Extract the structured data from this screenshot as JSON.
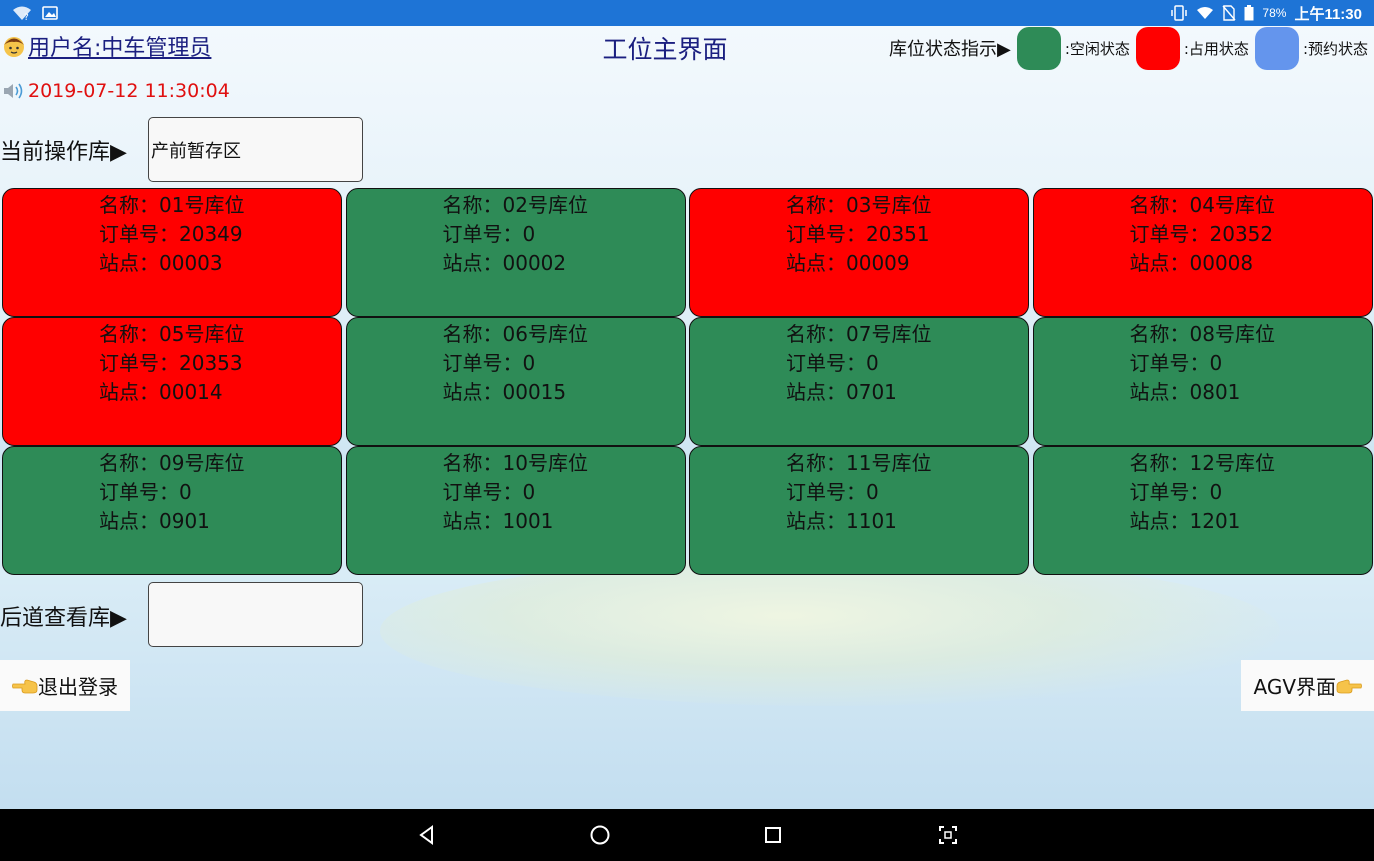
{
  "status_bar": {
    "battery": "78%",
    "time": "上午11:30",
    "icons": [
      "wifi-question-icon",
      "image-icon",
      "vibrate-icon",
      "wifi-icon",
      "no-sim-icon",
      "battery-icon"
    ]
  },
  "header": {
    "username": "用户名:中车管理员",
    "title": "工位主界面",
    "legend_title": "库位状态指示▶",
    "legend": [
      {
        "label": ":空闲状态",
        "color": "#2e8b57"
      },
      {
        "label": ":占用状态",
        "color": "#ff0000"
      },
      {
        "label": ":预约状态",
        "color": "#6495ed"
      }
    ]
  },
  "datetime": "2019-07-12 11:30:04",
  "current_store": {
    "label": "当前操作库▶",
    "value": "产前暂存区"
  },
  "back_store": {
    "label": "后道查看库▶",
    "value": ""
  },
  "slots": [
    {
      "name": "名称：01号库位",
      "order": "订单号：20349",
      "site": "站点：00003",
      "state": "busy"
    },
    {
      "name": "名称：02号库位",
      "order": "订单号：0",
      "site": "站点：00002",
      "state": "free"
    },
    {
      "name": "名称：03号库位",
      "order": "订单号：20351",
      "site": "站点：00009",
      "state": "busy"
    },
    {
      "name": "名称：04号库位",
      "order": "订单号：20352",
      "site": "站点：00008",
      "state": "busy"
    },
    {
      "name": "名称：05号库位",
      "order": "订单号：20353",
      "site": "站点：00014",
      "state": "busy"
    },
    {
      "name": "名称：06号库位",
      "order": "订单号：0",
      "site": "站点：00015",
      "state": "free"
    },
    {
      "name": "名称：07号库位",
      "order": "订单号：0",
      "site": "站点：0701",
      "state": "free"
    },
    {
      "name": "名称：08号库位",
      "order": "订单号：0",
      "site": "站点：0801",
      "state": "free"
    },
    {
      "name": "名称：09号库位",
      "order": "订单号：0",
      "site": "站点：0901",
      "state": "free"
    },
    {
      "name": "名称：10号库位",
      "order": "订单号：0",
      "site": "站点：1001",
      "state": "free"
    },
    {
      "name": "名称：11号库位",
      "order": "订单号：0",
      "site": "站点：1101",
      "state": "free"
    },
    {
      "name": "名称：12号库位",
      "order": "订单号：0",
      "site": "站点：1201",
      "state": "free"
    }
  ],
  "buttons": {
    "logout": "退出登录",
    "agv": "AGV界面"
  },
  "nav_bar": [
    "back-icon",
    "home-icon",
    "recents-icon",
    "screenshot-icon"
  ]
}
